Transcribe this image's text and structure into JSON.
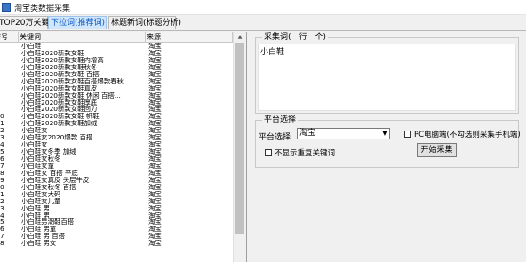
{
  "window": {
    "title": "淘宝类数据采集"
  },
  "tabs": [
    {
      "label": "TOP20万关键词",
      "active": false
    },
    {
      "label": "下拉词(推荐词)",
      "active": true
    },
    {
      "label": "标题新词(标题分析)",
      "active": false
    }
  ],
  "keyword_table": {
    "columns": [
      "序号",
      "关键词",
      "来源"
    ],
    "rows": [
      {
        "num": "",
        "keyword": "小白鞋",
        "source": "淘宝"
      },
      {
        "num": "",
        "keyword": "小白鞋2020新款女鞋",
        "source": "淘宝"
      },
      {
        "num": "",
        "keyword": "小白鞋2020新款女鞋内增高",
        "source": "淘宝"
      },
      {
        "num": "",
        "keyword": "小白鞋2020新款女鞋秋冬",
        "source": "淘宝"
      },
      {
        "num": "",
        "keyword": "小白鞋2020新款女鞋 百搭",
        "source": "淘宝"
      },
      {
        "num": "",
        "keyword": "小白鞋2020新款女鞋百搭爆款春秋",
        "source": "淘宝"
      },
      {
        "num": "",
        "keyword": "小白鞋2020新款女鞋真皮",
        "source": "淘宝"
      },
      {
        "num": "",
        "keyword": "小白鞋2020新款女鞋 休闲 百搭...",
        "source": "淘宝"
      },
      {
        "num": "",
        "keyword": "小白鞋2020新款女鞋厚底",
        "source": "淘宝"
      },
      {
        "num": "",
        "keyword": "小白鞋2020新款女鞋回力",
        "source": "淘宝"
      },
      {
        "num": "0",
        "keyword": "小白鞋2020新款女鞋 帆鞋",
        "source": "淘宝"
      },
      {
        "num": "1",
        "keyword": "小白鞋2020新款女鞋加绒",
        "source": "淘宝"
      },
      {
        "num": "2",
        "keyword": "小白鞋女",
        "source": "淘宝"
      },
      {
        "num": "3",
        "keyword": "小白鞋女2020爆款 百搭",
        "source": "淘宝"
      },
      {
        "num": "4",
        "keyword": "小白鞋女",
        "source": "淘宝"
      },
      {
        "num": "5",
        "keyword": "小白鞋女冬季 加绒",
        "source": "淘宝"
      },
      {
        "num": "6",
        "keyword": "小白鞋女秋冬",
        "source": "淘宝"
      },
      {
        "num": "7",
        "keyword": "小白鞋女童",
        "source": "淘宝"
      },
      {
        "num": "8",
        "keyword": "小白鞋女 百搭 平底",
        "source": "淘宝"
      },
      {
        "num": "9",
        "keyword": "小白鞋女真皮 头层牛皮",
        "source": "淘宝"
      },
      {
        "num": "0",
        "keyword": "小白鞋女秋冬 百搭",
        "source": "淘宝"
      },
      {
        "num": "1",
        "keyword": "小白鞋女大码",
        "source": "淘宝"
      },
      {
        "num": "2",
        "keyword": "小白鞋女儿童",
        "source": "淘宝"
      },
      {
        "num": "3",
        "keyword": "小白鞋 男",
        "source": "淘宝"
      },
      {
        "num": "4",
        "keyword": "小白鞋 男",
        "source": "淘宝"
      },
      {
        "num": "5",
        "keyword": "小白鞋男潮鞋百搭",
        "source": "淘宝"
      },
      {
        "num": "6",
        "keyword": "小白鞋 男童",
        "source": "淘宝"
      },
      {
        "num": "7",
        "keyword": "小白鞋 男 百搭",
        "source": "淘宝"
      },
      {
        "num": "8",
        "keyword": "小白鞋 男女",
        "source": "淘宝"
      }
    ]
  },
  "collect_group": {
    "legend": "采集词(一行一个)",
    "value": "小白鞋"
  },
  "platform_group": {
    "legend": "平台选择",
    "select_label": "平台选择",
    "selected": "淘宝",
    "pc_checkbox_label": "PC电脑端(不勾选则采集手机端)",
    "pc_checked": false,
    "dedupe_label": "不显示重复关键词",
    "dedupe_checked": false,
    "start_button": "开始采集"
  }
}
